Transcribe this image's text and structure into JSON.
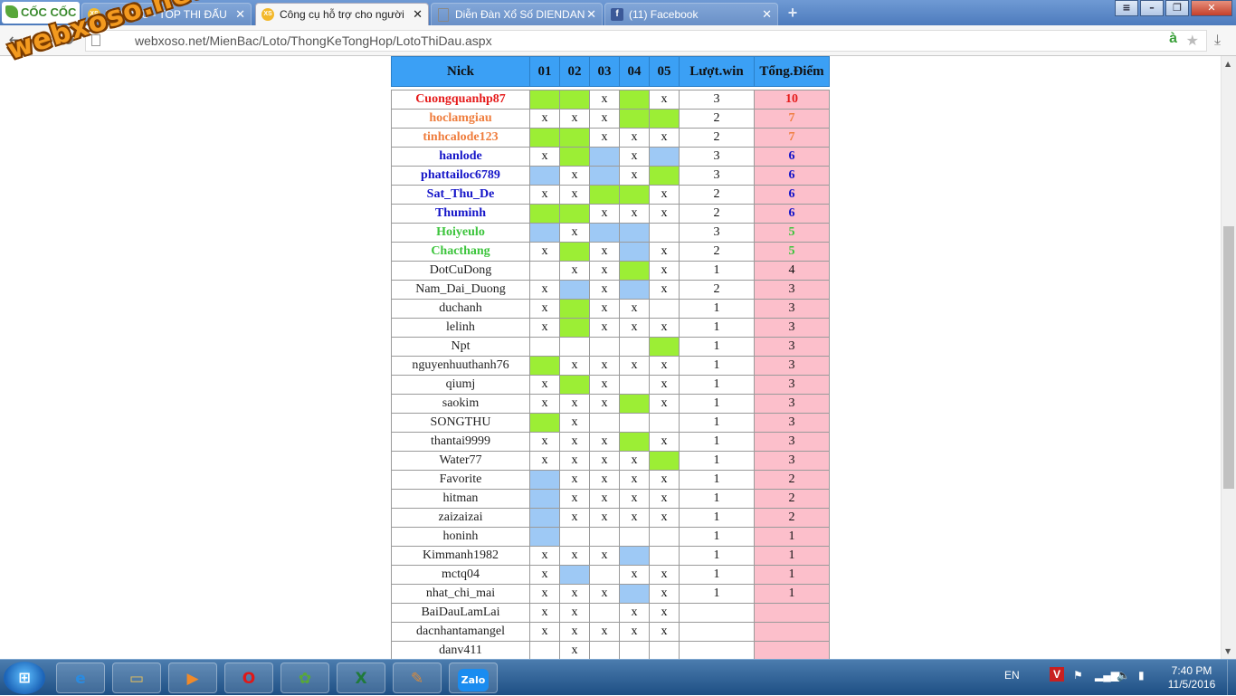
{
  "browser": {
    "brand": "CỐC CỐC",
    "tabs": [
      {
        "title": "THI ĐẤU - TOP THI ĐẤU",
        "icon": "xs-favicon",
        "state": "inactive"
      },
      {
        "title": "Công cụ hỗ trợ cho người",
        "icon": "xs-favicon",
        "state": "active"
      },
      {
        "title": "Diễn Đàn Xổ Số DIENDAN",
        "icon": "document-icon",
        "state": "inactive"
      },
      {
        "title": "(11) Facebook",
        "icon": "facebook-icon",
        "state": "inactive"
      }
    ],
    "url": "webxoso.net/MienBac/Loto/ThongKeTongHop/LotoThiDau.aspx",
    "watermark": "webxoso.net"
  },
  "table": {
    "headers": [
      "Nick",
      "01",
      "02",
      "03",
      "04",
      "05",
      "Lượt.win",
      "Tổng.Điểm"
    ],
    "rows": [
      {
        "nick": "Cuongquanhp87",
        "tone": "red",
        "cells": [
          "G",
          "G",
          "x",
          "G",
          "x"
        ],
        "win": "3",
        "total": "10"
      },
      {
        "nick": "hoclamgiau",
        "tone": "orange",
        "cells": [
          "x",
          "x",
          "x",
          "G",
          "G"
        ],
        "win": "2",
        "total": "7"
      },
      {
        "nick": "tinhcalode123",
        "tone": "orange",
        "cells": [
          "G",
          "G",
          "x",
          "x",
          "x"
        ],
        "win": "2",
        "total": "7"
      },
      {
        "nick": "hanlode",
        "tone": "blue",
        "cells": [
          "x",
          "G",
          "B",
          "x",
          "B"
        ],
        "win": "3",
        "total": "6"
      },
      {
        "nick": "phattailoc6789",
        "tone": "blue",
        "cells": [
          "B",
          "x",
          "B",
          "x",
          "G"
        ],
        "win": "3",
        "total": "6"
      },
      {
        "nick": "Sat_Thu_De",
        "tone": "blue",
        "cells": [
          "x",
          "x",
          "G",
          "G",
          "x"
        ],
        "win": "2",
        "total": "6"
      },
      {
        "nick": "Thuminh",
        "tone": "blue",
        "cells": [
          "G",
          "G",
          "x",
          "x",
          "x"
        ],
        "win": "2",
        "total": "6"
      },
      {
        "nick": "Hoiyeulo",
        "tone": "green",
        "cells": [
          "B",
          "x",
          "B",
          "B",
          ""
        ],
        "win": "3",
        "total": "5"
      },
      {
        "nick": "Chacthang",
        "tone": "green",
        "cells": [
          "x",
          "G",
          "x",
          "B",
          "x"
        ],
        "win": "2",
        "total": "5"
      },
      {
        "nick": "DotCuDong",
        "tone": "plain",
        "cells": [
          "",
          "x",
          "x",
          "G",
          "x"
        ],
        "win": "1",
        "total": "4"
      },
      {
        "nick": "Nam_Dai_Duong",
        "tone": "plain",
        "cells": [
          "x",
          "B",
          "x",
          "B",
          "x"
        ],
        "win": "2",
        "total": "3"
      },
      {
        "nick": "duchanh",
        "tone": "plain",
        "cells": [
          "x",
          "G",
          "x",
          "x",
          ""
        ],
        "win": "1",
        "total": "3"
      },
      {
        "nick": "lelinh",
        "tone": "plain",
        "cells": [
          "x",
          "G",
          "x",
          "x",
          "x"
        ],
        "win": "1",
        "total": "3"
      },
      {
        "nick": "Npt",
        "tone": "plain",
        "cells": [
          "",
          "",
          "",
          "",
          "G"
        ],
        "win": "1",
        "total": "3"
      },
      {
        "nick": "nguyenhuuthanh76",
        "tone": "plain",
        "cells": [
          "G",
          "x",
          "x",
          "x",
          "x"
        ],
        "win": "1",
        "total": "3"
      },
      {
        "nick": "qiumj",
        "tone": "plain",
        "cells": [
          "x",
          "G",
          "x",
          "",
          "x"
        ],
        "win": "1",
        "total": "3"
      },
      {
        "nick": "saokim",
        "tone": "plain",
        "cells": [
          "x",
          "x",
          "x",
          "G",
          "x"
        ],
        "win": "1",
        "total": "3"
      },
      {
        "nick": "SONGTHU",
        "tone": "plain",
        "cells": [
          "G",
          "x",
          "",
          "",
          ""
        ],
        "win": "1",
        "total": "3"
      },
      {
        "nick": "thantai9999",
        "tone": "plain",
        "cells": [
          "x",
          "x",
          "x",
          "G",
          "x"
        ],
        "win": "1",
        "total": "3"
      },
      {
        "nick": "Water77",
        "tone": "plain",
        "cells": [
          "x",
          "x",
          "x",
          "x",
          "G"
        ],
        "win": "1",
        "total": "3"
      },
      {
        "nick": "Favorite",
        "tone": "plain",
        "cells": [
          "B",
          "x",
          "x",
          "x",
          "x"
        ],
        "win": "1",
        "total": "2"
      },
      {
        "nick": "hitman",
        "tone": "plain",
        "cells": [
          "B",
          "x",
          "x",
          "x",
          "x"
        ],
        "win": "1",
        "total": "2"
      },
      {
        "nick": "zaizaizai",
        "tone": "plain",
        "cells": [
          "B",
          "x",
          "x",
          "x",
          "x"
        ],
        "win": "1",
        "total": "2"
      },
      {
        "nick": "honinh",
        "tone": "plain",
        "cells": [
          "B",
          "",
          "",
          "",
          ""
        ],
        "win": "1",
        "total": "1"
      },
      {
        "nick": "Kimmanh1982",
        "tone": "plain",
        "cells": [
          "x",
          "x",
          "x",
          "B",
          ""
        ],
        "win": "1",
        "total": "1"
      },
      {
        "nick": "mctq04",
        "tone": "plain",
        "cells": [
          "x",
          "B",
          "",
          "x",
          "x"
        ],
        "win": "1",
        "total": "1"
      },
      {
        "nick": "nhat_chi_mai",
        "tone": "plain",
        "cells": [
          "x",
          "x",
          "x",
          "B",
          "x"
        ],
        "win": "1",
        "total": "1"
      },
      {
        "nick": "BaiDauLamLai",
        "tone": "plain",
        "cells": [
          "x",
          "x",
          "",
          "x",
          "x"
        ],
        "win": "",
        "total": ""
      },
      {
        "nick": "dacnhantamangel",
        "tone": "plain",
        "cells": [
          "x",
          "x",
          "x",
          "x",
          "x"
        ],
        "win": "",
        "total": ""
      },
      {
        "nick": "danv411",
        "tone": "plain",
        "cells": [
          "",
          "x",
          "",
          "",
          ""
        ],
        "win": "",
        "total": ""
      }
    ]
  },
  "scrollbar": {
    "thumb_top_fraction": 0.27,
    "thumb_size_fraction": 0.46
  },
  "taskbar": {
    "apps": [
      {
        "name": "internet-explorer-icon",
        "glyph": "e",
        "color": "#2a8be0"
      },
      {
        "name": "file-explorer-icon",
        "glyph": "▭",
        "color": "#e8c05a"
      },
      {
        "name": "media-player-icon",
        "glyph": "▶",
        "color": "#f08a2a"
      },
      {
        "name": "opera-icon",
        "glyph": "O",
        "color": "#e01818"
      },
      {
        "name": "coccoc-icon",
        "glyph": "✿",
        "color": "#58a73a"
      },
      {
        "name": "excel-icon",
        "glyph": "X",
        "color": "#1f7a3a"
      },
      {
        "name": "paint-icon",
        "glyph": "✎",
        "color": "#d98a3a"
      },
      {
        "name": "zalo-icon",
        "glyph": "Zalo",
        "color": "#1a8cf0"
      }
    ],
    "language": "EN",
    "time": "7:40 PM",
    "date": "11/5/2016"
  }
}
